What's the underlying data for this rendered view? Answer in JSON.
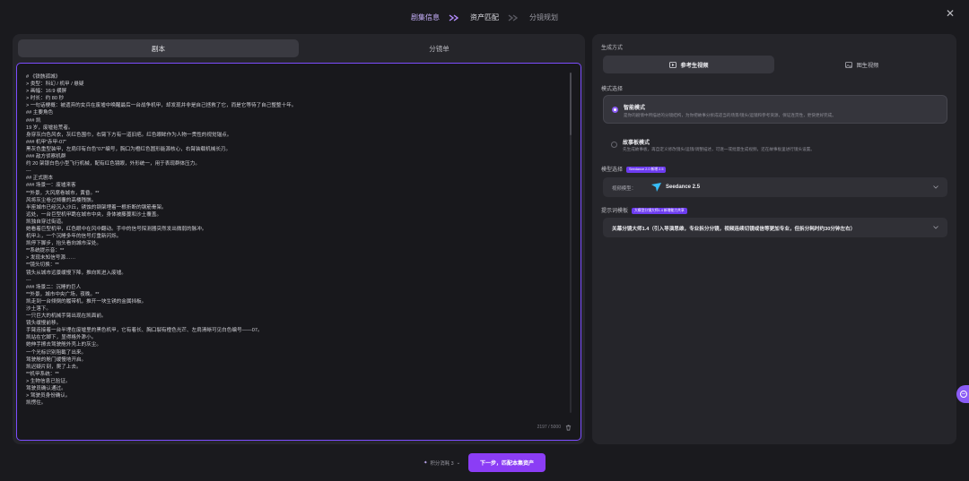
{
  "stepper": {
    "steps": [
      "剧集信息",
      "资产匹配",
      "分镜规划"
    ]
  },
  "left": {
    "tabs": [
      "剧本",
      "分镜单"
    ],
    "script_lines": [
      "# 《铁骸孤城》",
      "> 类型：科幻 / 机甲 / 悬疑",
      "> 画幅：16:9 横屏",
      "> 时长：约 80 秒",
      "> 一句话梗概：被遗弃的女兵在废墟中唤醒最后一台战争机甲，却发现并非是自己拯救了它，而是它等待了自己整整十年。",
      "## 主要角色",
      "### 凯",
      "19 岁，废墟拾荒者。",
      "身穿灰白色风衣，灰红色围巾，右臂下方有一道旧疤。红色眼眸作为人物一贯性的视觉锚点。",
      "### 机甲“赤甲-07”",
      "黑灰色重型装甲，左肩印有白色“07”编号，胸口为橙红色圆形能源核心，右臂装载机械长刃。",
      "### 敌方侦察机群",
      "约 20 架银白色小型飞行机械，配有红色镜眼，外形统一，用于表现群体压力。",
      "---",
      "## 正式剧本",
      "### 场景一：废墟来客",
      "**外景，大风席卷城市，黄昏。**",
      "风将灰尘卷过倾覆的高楼残骸。",
      "半座城市已经沉入沙丘，锈蚀的钢架埋着一根折断的钢筋骨架。",
      "远处，一台巨型机甲跪在城市中央，身体被藤蔓和沙土覆盖。",
      "凯独自穿过街道。",
      "她看着巨型机甲，红色眼中在风中翻动。手中的信号探测器突然发出微弱的脉冲。",
      "机甲上，一个沉睡多年的信号灯重新闪烁。",
      "凯停下脚步，抬头看向城市深处。",
      "**系统提示音：**",
      "> 发现未知信号源……",
      "**镜头切换：**",
      "镜头从城市远景缓慢下降，推向凯进入废墟。",
      "---",
      "### 场景二：沉睡的巨人",
      "**外景，城市中央广场，夜晚。**",
      "凯走到一台倾倒的履带机，推开一块生锈的金属挡板。",
      "沙土落下。",
      "一只巨大的机械手臂出现在凯面前。",
      "镜头缓慢前移。",
      "手臂连接着一台半埋在废墟里的黑色机甲，它有着长、胸口裂有橙色光芒、左肩清晰可见白色编号——07。",
      "凯站在它脚下，显得格外渺小。",
      "她伸手擦去驾驶舱外壳上的灰尘。",
      "一个光标识别阻截了出来。",
      "驾驶舱的舱门缓慢地开启。",
      "凯迟疑片刻，爬了上去。",
      "**机甲系统：**",
      "> 生物信息已验证。",
      "驾驶员确认通过。",
      "> 驾驶员身份确认。",
      "凯愣住。"
    ],
    "char_count": "2197 / 5000"
  },
  "right": {
    "gen_label": "生成方式",
    "gen_options": [
      "参考生视频",
      "图生视频"
    ],
    "mode_label": "模式选择",
    "modes": [
      {
        "title": "智能模式",
        "desc": "是你的剧情中所描述的分镜结构，为你把故事分拆成适当的场景/镜头/运镜和参考资源，保证连贯性，更快更好完成。"
      },
      {
        "title": "故事板模式",
        "desc": "先生成故事板，再自定义修改镜头/运镜/调整描述，可逐一或批量生成视频，还在故事板里进行镜头设置。"
      }
    ],
    "model_label": "模型选择",
    "model_badge": "Seedance 2.0 新增 2.5",
    "model_field_label": "视频模型：",
    "model_value": "Seedance 2.5",
    "prompt_label": "提示词模板",
    "prompt_badge": "大模型分镜大师1.4 新增能力共享",
    "prompt_value": "关幕分镜大师1.4（引入导演思维，专业拆分分镜，视频连续切镜或信等更加专业，但拆分耗时约30分钟左右）"
  },
  "footer": {
    "points": "积分消耗 3",
    "next_label": "下一步，匹配本集资产"
  },
  "colors": {
    "accent": "#8b5cf6",
    "button": "#8b3df5"
  }
}
